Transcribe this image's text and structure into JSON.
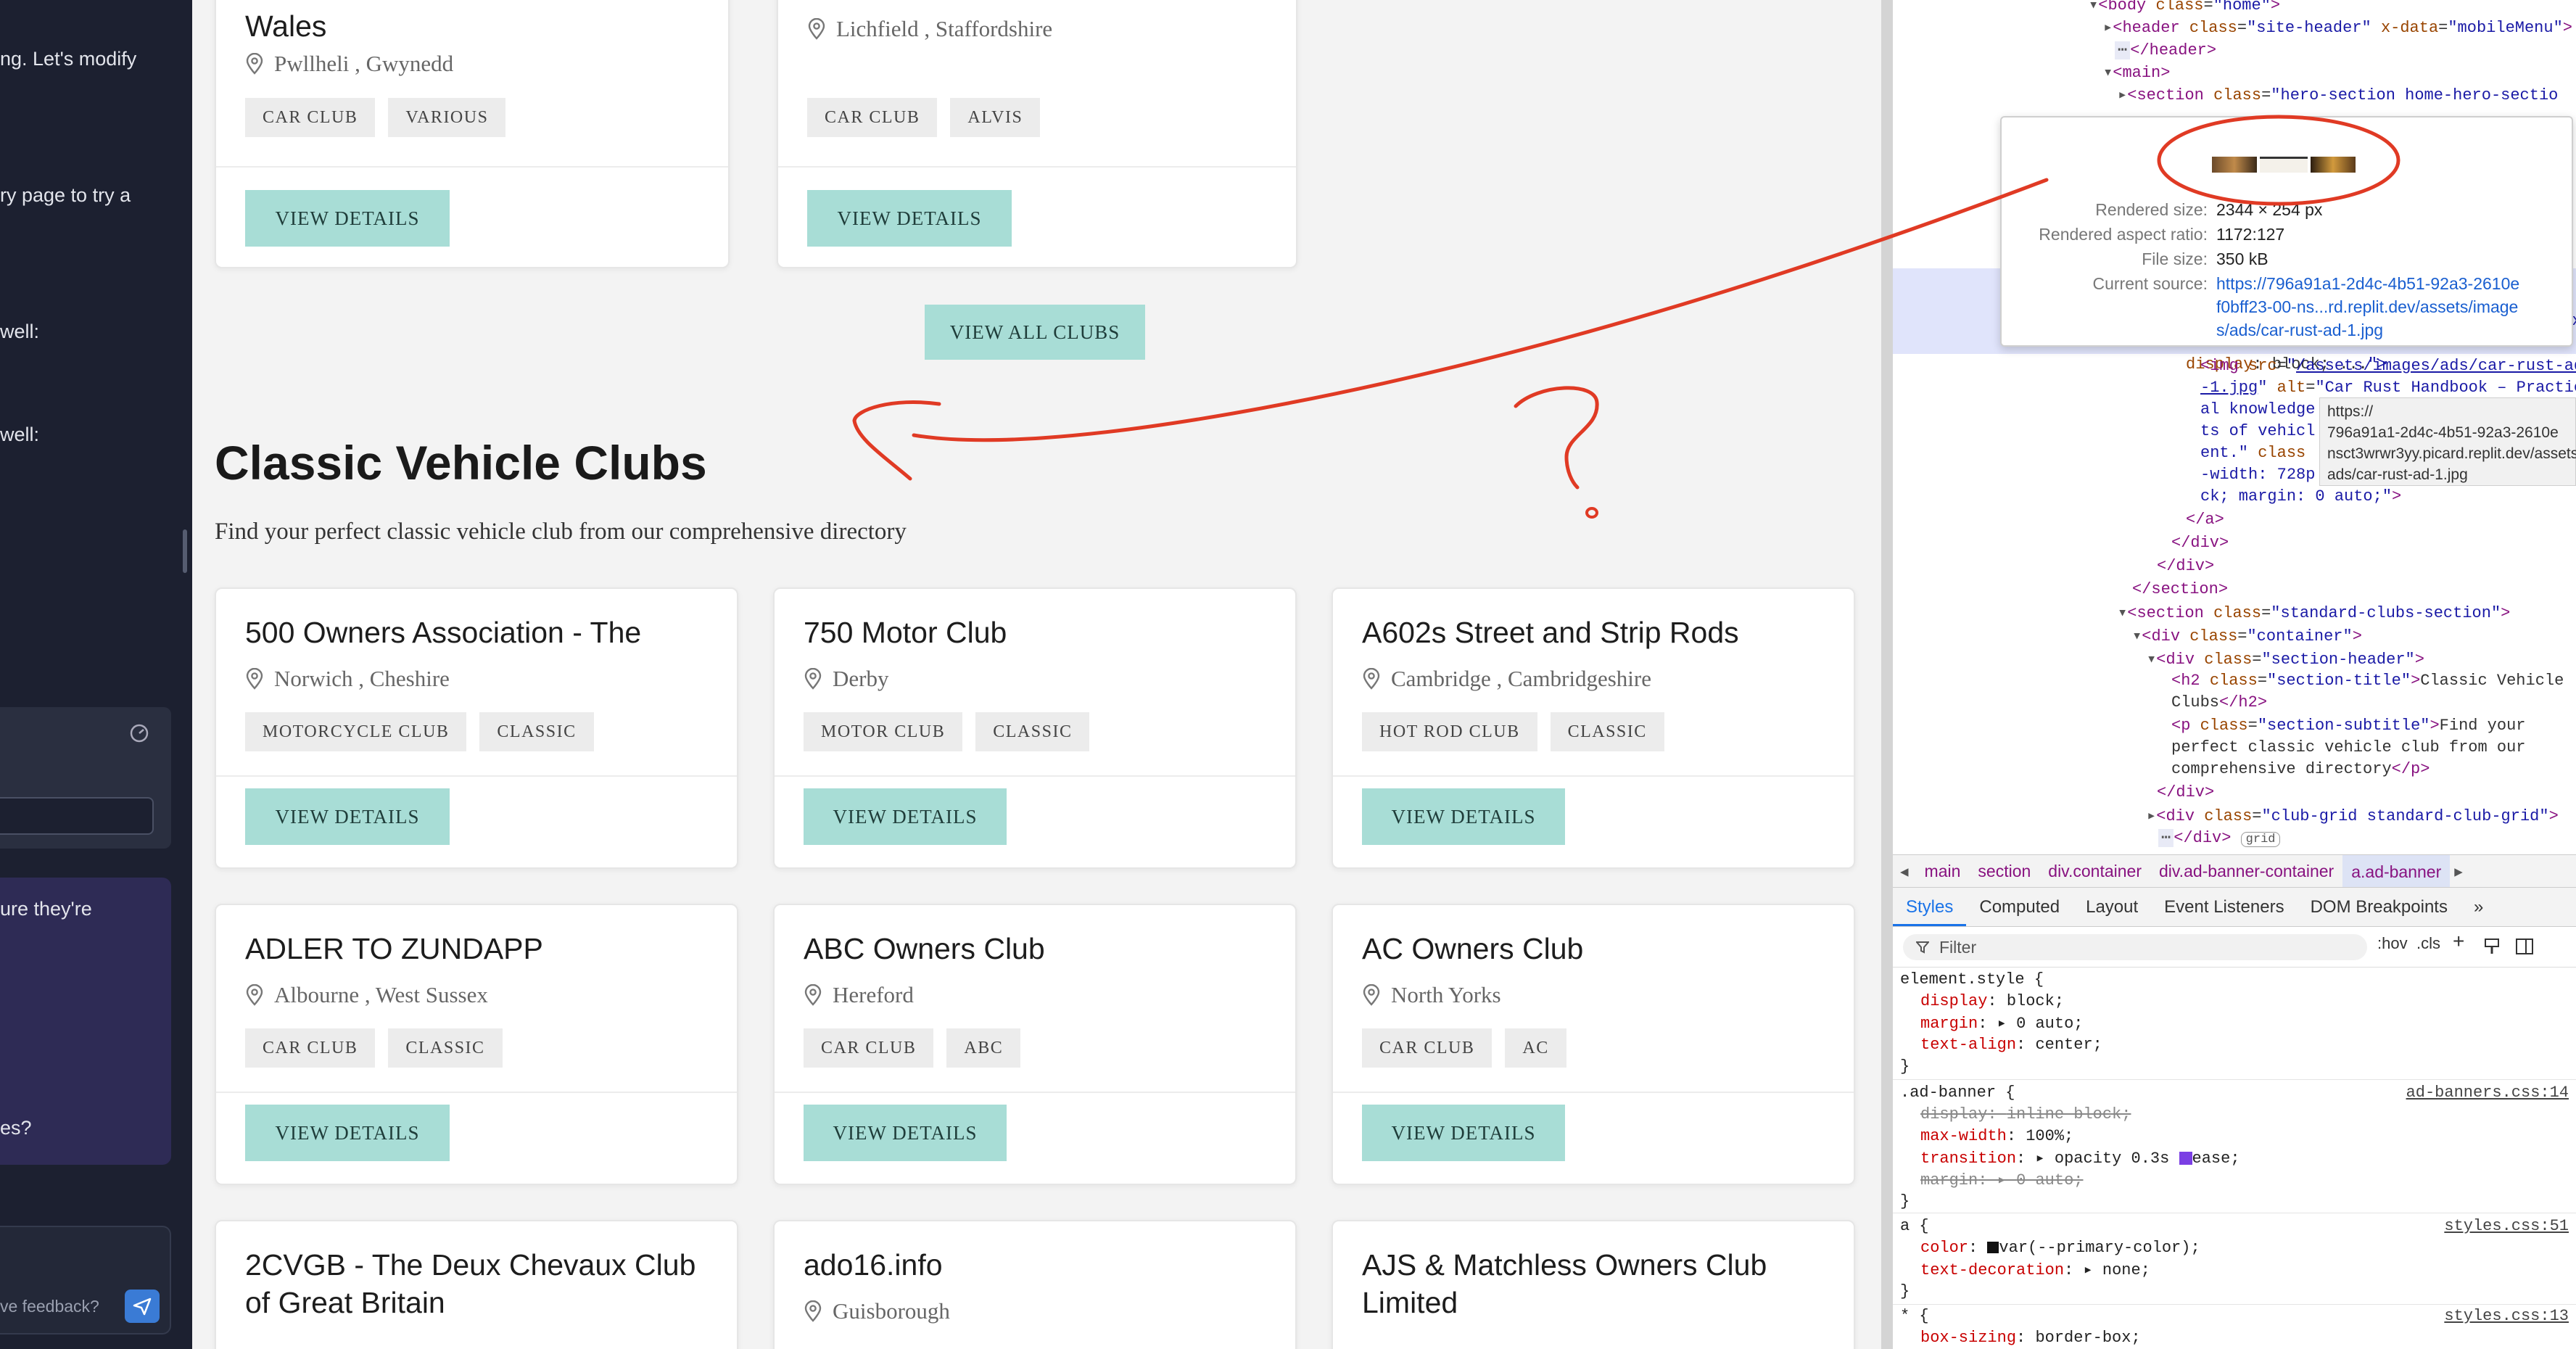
{
  "chat": {
    "lines": [
      "ng. Let's modify",
      "ry page to try a",
      "well:",
      "well:",
      "ure they're",
      "es?"
    ],
    "feedback_placeholder": "ve feedback?"
  },
  "page": {
    "top_cards": [
      {
        "name": "Wales",
        "location": "Pwllheli , Gwynedd",
        "tags": [
          "CAR CLUB",
          "VARIOUS"
        ],
        "button": "VIEW DETAILS"
      },
      {
        "name": "",
        "location": "Lichfield , Staffordshire",
        "tags": [
          "CAR CLUB",
          "ALVIS"
        ],
        "button": "VIEW DETAILS"
      }
    ],
    "view_all": "VIEW ALL CLUBS",
    "section_title": "Classic Vehicle Clubs",
    "section_subtitle": "Find your perfect classic vehicle club from our comprehensive directory",
    "clubs": [
      {
        "name": "500 Owners Association - The",
        "location": "Norwich , Cheshire",
        "tags": [
          "MOTORCYCLE CLUB",
          "CLASSIC"
        ],
        "button": "VIEW DETAILS"
      },
      {
        "name": "750 Motor Club",
        "location": "Derby",
        "tags": [
          "MOTOR CLUB",
          "CLASSIC"
        ],
        "button": "VIEW DETAILS"
      },
      {
        "name": "A602s Street and Strip Rods",
        "location": "Cambridge , Cambridgeshire",
        "tags": [
          "HOT ROD CLUB",
          "CLASSIC"
        ],
        "button": "VIEW DETAILS"
      },
      {
        "name": "ADLER TO ZUNDAPP",
        "location": "Albourne , West Sussex",
        "tags": [
          "CAR CLUB",
          "CLASSIC"
        ],
        "button": "VIEW DETAILS"
      },
      {
        "name": "ABC Owners Club",
        "location": "Hereford",
        "tags": [
          "CAR CLUB",
          "ABC"
        ],
        "button": "VIEW DETAILS"
      },
      {
        "name": "AC Owners Club",
        "location": "North Yorks",
        "tags": [
          "CAR CLUB",
          "AC"
        ],
        "button": "VIEW DETAILS"
      },
      {
        "name": "2CVGB - The Deux Chevaux Club",
        "name2": "of Great Britain",
        "location": "",
        "tags": [],
        "button": ""
      },
      {
        "name": "ado16.info",
        "location": "Guisborough",
        "tags": [],
        "button": ""
      },
      {
        "name": "AJS & Matchless Owners Club",
        "name2": "Limited",
        "location": "",
        "tags": [],
        "button": ""
      }
    ]
  },
  "devtools": {
    "tooltip": {
      "rendered_size_label": "Rendered size:",
      "rendered_size": "2344 × 254 px",
      "aspect_label": "Rendered aspect ratio:",
      "aspect": "1172:127",
      "file_size_label": "File size:",
      "file_size": "350 kB",
      "source_label": "Current source:",
      "source_lines": [
        "https://796a91a1-2d4c-4b51-92a3-2610e",
        "f0bff23-00-ns...rd.replit.dev/assets/image",
        "s/ads/car-rust-ad-1.jpg"
      ]
    },
    "url_tooltip": [
      "https://",
      "796a91a1-2d4c-4b51-92a3-2610e",
      "nsct3wrwr3yy.picard.replit.dev/assets/im",
      "ads/car-rust-ad-1.jpg"
    ],
    "breadcrumbs": [
      "main",
      "section",
      "div.container",
      "div.ad-banner-container",
      "a.ad-banner"
    ],
    "tabs": [
      "Styles",
      "Computed",
      "Layout",
      "Event Listeners",
      "DOM Breakpoints"
    ],
    "filter_placeholder": "Filter",
    "filter_hov": ":hov",
    "filter_cls": ".cls",
    "styles": {
      "element_style": "element.style {",
      "es_props": [
        [
          "display",
          "block;"
        ],
        [
          "margin",
          "0 auto;"
        ],
        [
          "text-align",
          "center;"
        ]
      ],
      "ad_banner_selector": ".ad-banner {",
      "ad_banner_source": "ad-banners.css:14",
      "ad_props": [
        [
          "display",
          "inline-block;"
        ],
        [
          "max-width",
          "100%;"
        ],
        [
          "transition",
          "opacity 0.3s"
        ],
        [
          "margin",
          "0 auto;"
        ]
      ],
      "ease": "ease;",
      "a_selector": "a {",
      "a_source": "styles.css:51",
      "a_props": [
        [
          "color",
          "var(--primary-color);"
        ],
        [
          "text-decoration",
          "none;"
        ]
      ],
      "star_selector": "* {",
      "star_source": "styles.css:13",
      "star_props": [
        [
          "box-sizing",
          "border-box;"
        ]
      ],
      "close": "}"
    }
  },
  "annotation": {
    "color": "#e03a24",
    "question_mark": "?"
  },
  "colors": {
    "button_bg": "#a8ddd6",
    "sidebar_bg": "#1c2030",
    "page_bg": "#f3f3f3"
  }
}
